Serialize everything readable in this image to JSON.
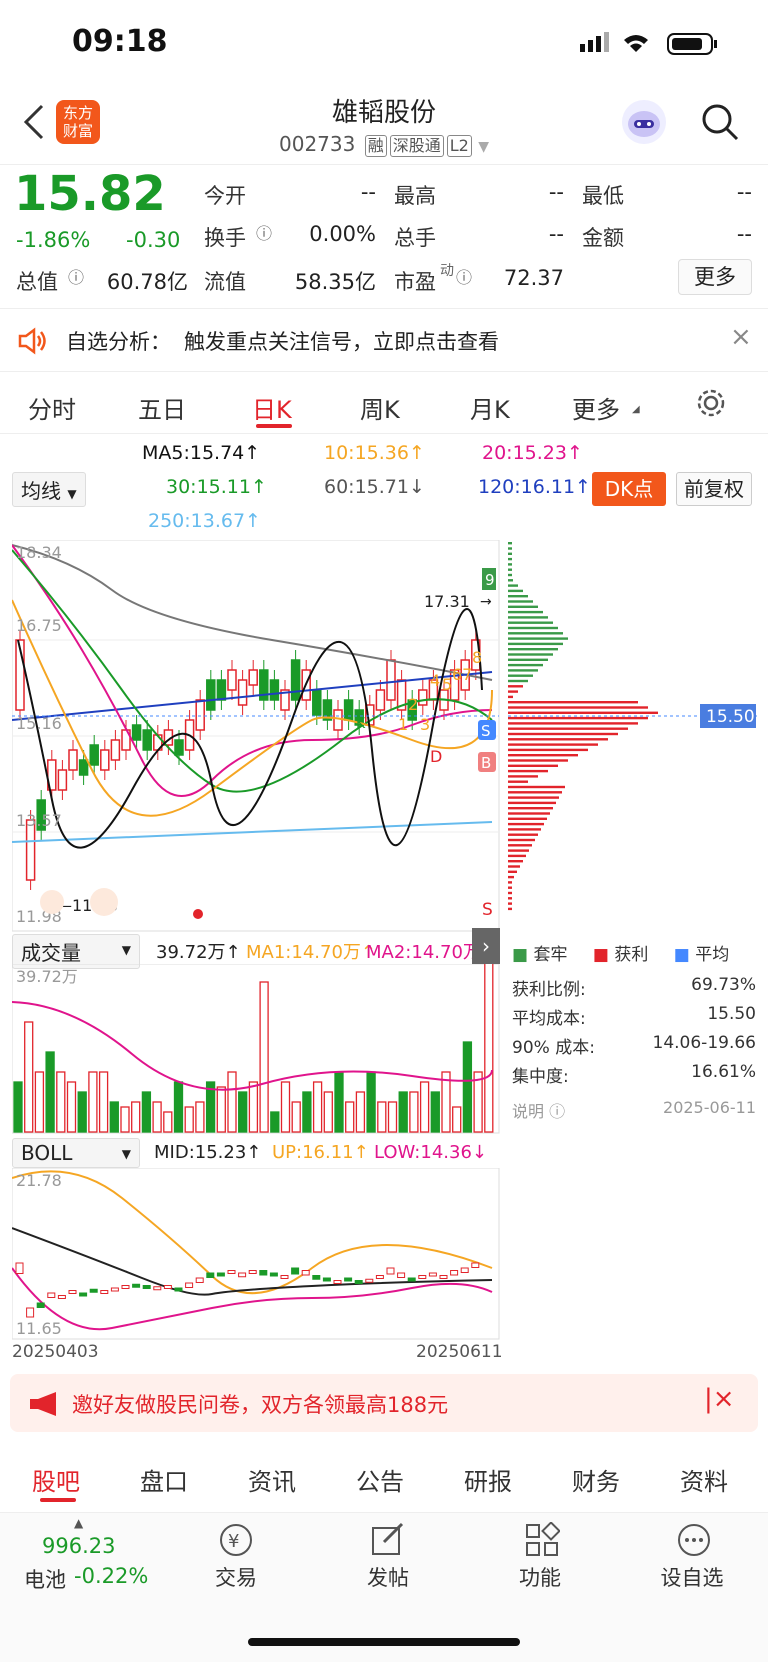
{
  "status": {
    "time": "09:18"
  },
  "header": {
    "title": "雄韬股份",
    "code": "002733",
    "tags": [
      "融",
      "深股通",
      "L2"
    ],
    "logo_text": "东方财富"
  },
  "quote": {
    "price": "15.82",
    "change_pct": "-1.86%",
    "change": "-0.30",
    "open_label": "今开",
    "open": "--",
    "high_label": "最高",
    "high": "--",
    "low_label": "最低",
    "low": "--",
    "turnover_label": "换手",
    "turnover": "0.00%",
    "vol_label": "总手",
    "vol": "--",
    "amount_label": "金额",
    "amount": "--",
    "mcap_label": "总值",
    "mcap": "60.78亿",
    "float_label": "流值",
    "float": "58.35亿",
    "pe_label": "市盈",
    "pe_sup": "动",
    "pe": "72.37",
    "more": "更多"
  },
  "notice": {
    "label": "自选分析：",
    "text": "触发重点关注信号，立即点击查看"
  },
  "tabs": [
    "分时",
    "五日",
    "日K",
    "周K",
    "月K",
    "更多"
  ],
  "ma": {
    "selector": "均线",
    "ma5": "MA5:15.74↑",
    "ma10": "10:15.36↑",
    "ma20": "20:15.23↑",
    "ma30": "30:15.11↑",
    "ma60": "60:15.71↓",
    "ma120": "120:16.11↑",
    "ma250": "250:13.67↑",
    "dk": "DK点",
    "fq": "前复权"
  },
  "kchart": {
    "ymax": "18.34",
    "y2": "16.75",
    "y3": "15.16",
    "y4": "13.57",
    "ymin": "11.98",
    "peak": "17.31",
    "low_mark": "11.98",
    "cost_line": "15.50",
    "markers": [
      "9",
      "8",
      "67",
      "4",
      "5",
      "2",
      "1",
      "3",
      "D",
      "S",
      "B",
      "K",
      "S"
    ]
  },
  "chips": {
    "legend": [
      "套牢",
      "获利",
      "平均"
    ],
    "rows": [
      {
        "k": "获利比例:",
        "v": "69.73%"
      },
      {
        "k": "平均成本:",
        "v": "15.50"
      },
      {
        "k": "90% 成本:",
        "v": "14.06-19.66"
      },
      {
        "k": "集中度:",
        "v": "16.61%"
      }
    ],
    "note": "说明",
    "date": "2025-06-11"
  },
  "vol": {
    "selector": "成交量",
    "value": "39.72万↑",
    "ma1": "MA1:14.70万↑",
    "ma2": "MA2:14.70万↑",
    "ymax": "39.72万"
  },
  "boll": {
    "selector": "BOLL",
    "mid": "MID:15.23↑",
    "up": "UP:16.11↑",
    "low": "LOW:14.36↓",
    "ymax": "21.78",
    "ymin": "11.65",
    "d1": "20250403",
    "d2": "20250611"
  },
  "banner": {
    "text": "邀好友做股民问卷，双方各领最高188元"
  },
  "btabs": [
    "股吧",
    "盘口",
    "资讯",
    "公告",
    "研报",
    "财务",
    "资料"
  ],
  "bottom": {
    "index": "996.23",
    "index_name": "电池",
    "index_chg": "-0.22%",
    "items": [
      "交易",
      "发帖",
      "功能",
      "设自选"
    ]
  },
  "colors": {
    "up": "#e2242b",
    "down": "#1a9a28",
    "ma5": "#111111",
    "ma10": "#f5a623",
    "ma20": "#e0148c",
    "ma30": "#1a9a28",
    "ma60": "#777777",
    "ma120": "#1f3fbf",
    "ma250": "#66bbee"
  }
}
